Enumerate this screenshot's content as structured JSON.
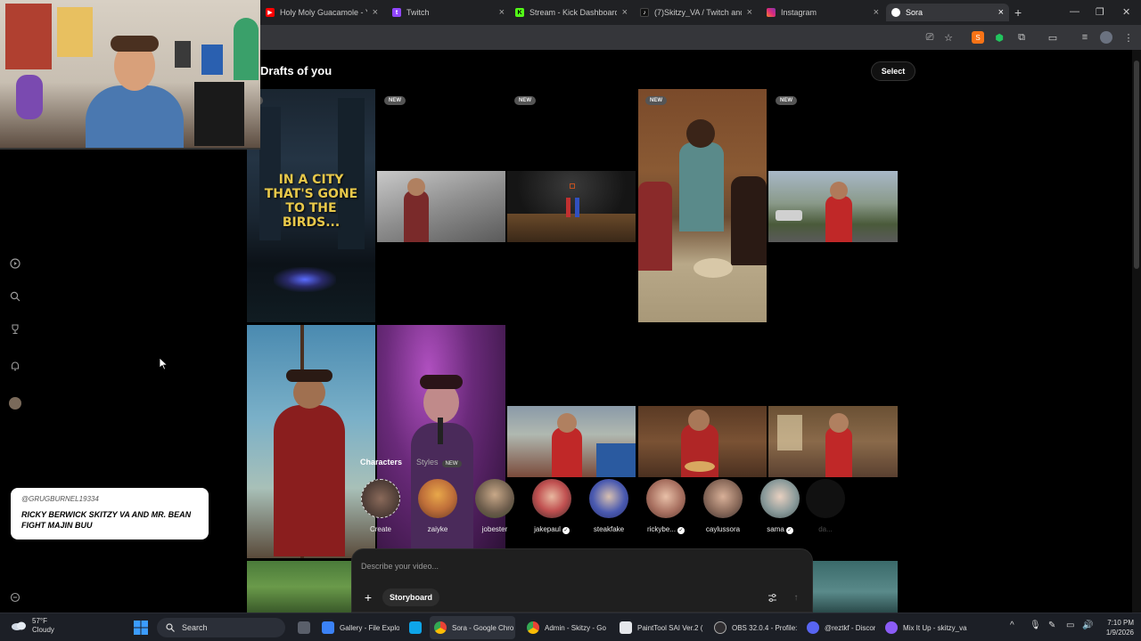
{
  "browser": {
    "tabs": [
      {
        "title": "Holy Moly Guacamole - Y",
        "icon": "youtube-icon",
        "color": "#ff0000"
      },
      {
        "title": "Twitch",
        "icon": "twitch-icon",
        "color": "#9146ff"
      },
      {
        "title": "Stream - Kick Dashboard",
        "icon": "kick-icon",
        "color": "#53fc18"
      },
      {
        "title": "(7)Skitzy_VA / Twitch and",
        "icon": "tiktok-icon",
        "color": "#111111"
      },
      {
        "title": "Instagram",
        "icon": "instagram-icon",
        "color": "#e1306c"
      },
      {
        "title": "Sora",
        "icon": "sora-icon",
        "color": "#ffffff"
      }
    ],
    "active_tab": "Sora"
  },
  "sora": {
    "page_title": "Drafts of you",
    "select_label": "Select",
    "new_badge": "NEW",
    "poster_text": "IN A CITY THAT'S GONE TO THE BIRDS..."
  },
  "composer": {
    "tab_characters": "Characters",
    "tab_styles": "Styles",
    "styles_badge": "NEW",
    "characters": [
      {
        "name": "Create",
        "verified": false
      },
      {
        "name": "zaiyke",
        "verified": false
      },
      {
        "name": "jobester",
        "verified": false
      },
      {
        "name": "jakepaul",
        "verified": true
      },
      {
        "name": "steakfake",
        "verified": false
      },
      {
        "name": "rickybe...",
        "verified": true
      },
      {
        "name": "caylussora",
        "verified": false
      },
      {
        "name": "sama",
        "verified": true
      },
      {
        "name": "da...",
        "verified": false
      }
    ],
    "placeholder": "Describe your video...",
    "storyboard_label": "Storyboard"
  },
  "stream_overlay": {
    "chat_handle": "@GRUGBURNEL19334",
    "chat_message": "RICKY BERWICK SKITZY VA AND MR. BEAN FIGHT MAJIN BUU"
  },
  "taskbar": {
    "temperature": "57°F",
    "condition": "Cloudy",
    "search_label": "Search",
    "apps": [
      {
        "label": "Gallery - File Explo",
        "color": "#3b82f6"
      },
      {
        "label": "Sora - Google Chro",
        "color": "#4285f4"
      },
      {
        "label": "Admin - Skitzy - Go",
        "color": "#4285f4"
      },
      {
        "label": "PaintTool SAI Ver.2 (",
        "color": "#e5e7eb"
      },
      {
        "label": "OBS 32.0.4 - Profile:",
        "color": "#302e31"
      },
      {
        "label": "@reztkf - Discord",
        "color": "#5865f2"
      },
      {
        "label": "Mix It Up - skitzy_va",
        "color": "#8b5cf6"
      }
    ],
    "time": "7:10 PM",
    "date": "1/9/2026"
  }
}
